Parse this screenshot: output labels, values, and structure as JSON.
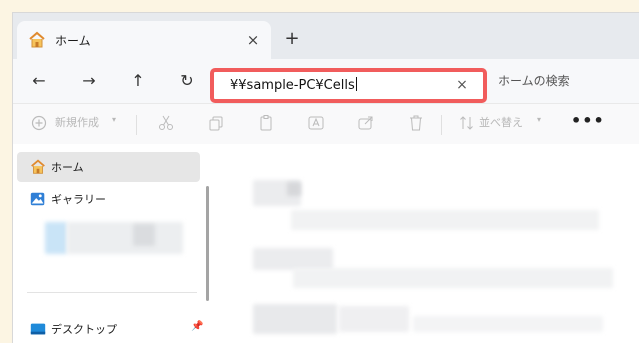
{
  "tab": {
    "title": "ホーム",
    "close": "×"
  },
  "newtab": "+",
  "nav": {
    "back": "←",
    "forward": "→",
    "up": "↑",
    "refresh": "↻"
  },
  "address": {
    "value": "¥¥sample-PC¥Cells",
    "clear": "×"
  },
  "search": {
    "placeholder": "ホームの検索"
  },
  "toolbar": {
    "new_label": "新規作成",
    "sort_label": "並べ替え",
    "more": "•••"
  },
  "sidebar": {
    "items": [
      {
        "label": "ホーム"
      },
      {
        "label": "ギャラリー"
      },
      {
        "label": "デスクトップ"
      }
    ]
  },
  "colors": {
    "highlight_border": "#f15c5c",
    "page_background": "#fcf5e3"
  }
}
